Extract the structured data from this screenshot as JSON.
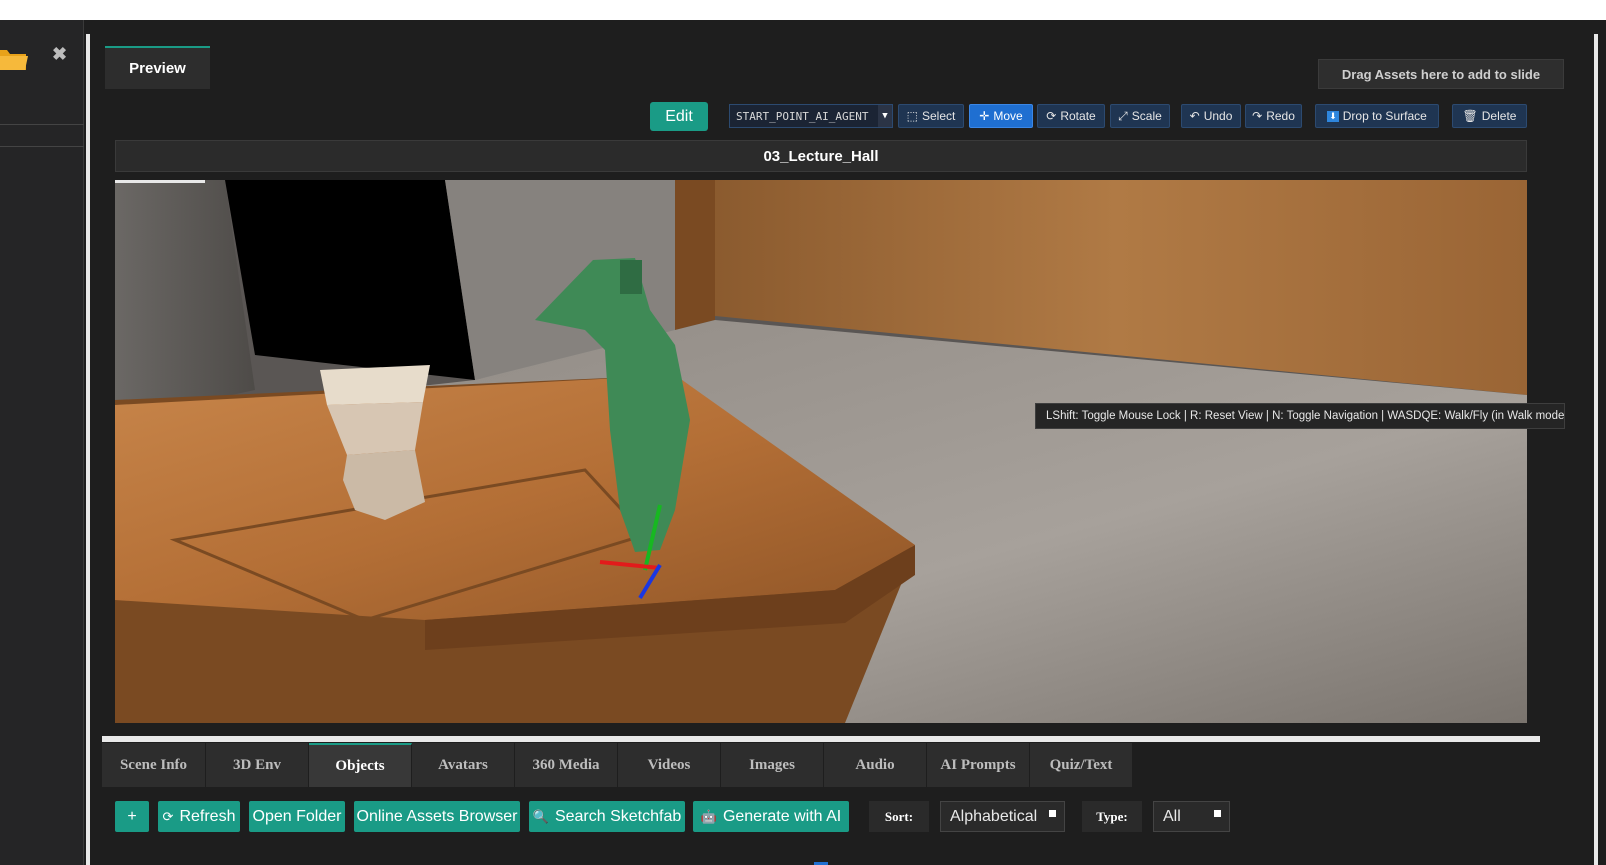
{
  "preview_tab": "Preview",
  "drag_hint": "Drag Assets here to add to slide",
  "toolbar": {
    "edit": "Edit",
    "object_select": "START_POINT_AI_AGENT",
    "select": "Select",
    "move": "Move",
    "rotate": "Rotate",
    "scale": "Scale",
    "undo": "Undo",
    "redo": "Redo",
    "drop": "Drop to Surface",
    "delete": "Delete"
  },
  "scene_title": "03_Lecture_Hall",
  "viewport_hint": "LShift: Toggle Mouse Lock | R: Reset View | N: Toggle Navigation | WASDQE: Walk/Fly (in Walk mode)",
  "tabs": [
    "Scene Info",
    "3D Env",
    "Objects",
    "Avatars",
    "360 Media",
    "Videos",
    "Images",
    "Audio",
    "AI Prompts",
    "Quiz/Text"
  ],
  "active_tab": "Objects",
  "bottom": {
    "add": "+",
    "refresh": "Refresh",
    "open_folder": "Open Folder",
    "online_assets": "Online Assets Browser",
    "search_sketchfab": "Search Sketchfab",
    "generate_ai": "Generate with AI",
    "sort_label": "Sort:",
    "sort_value": "Alphabetical",
    "type_label": "Type:",
    "type_value": "All"
  },
  "colors": {
    "accent": "#1a9b86",
    "active_blue": "#1f6fd1"
  }
}
